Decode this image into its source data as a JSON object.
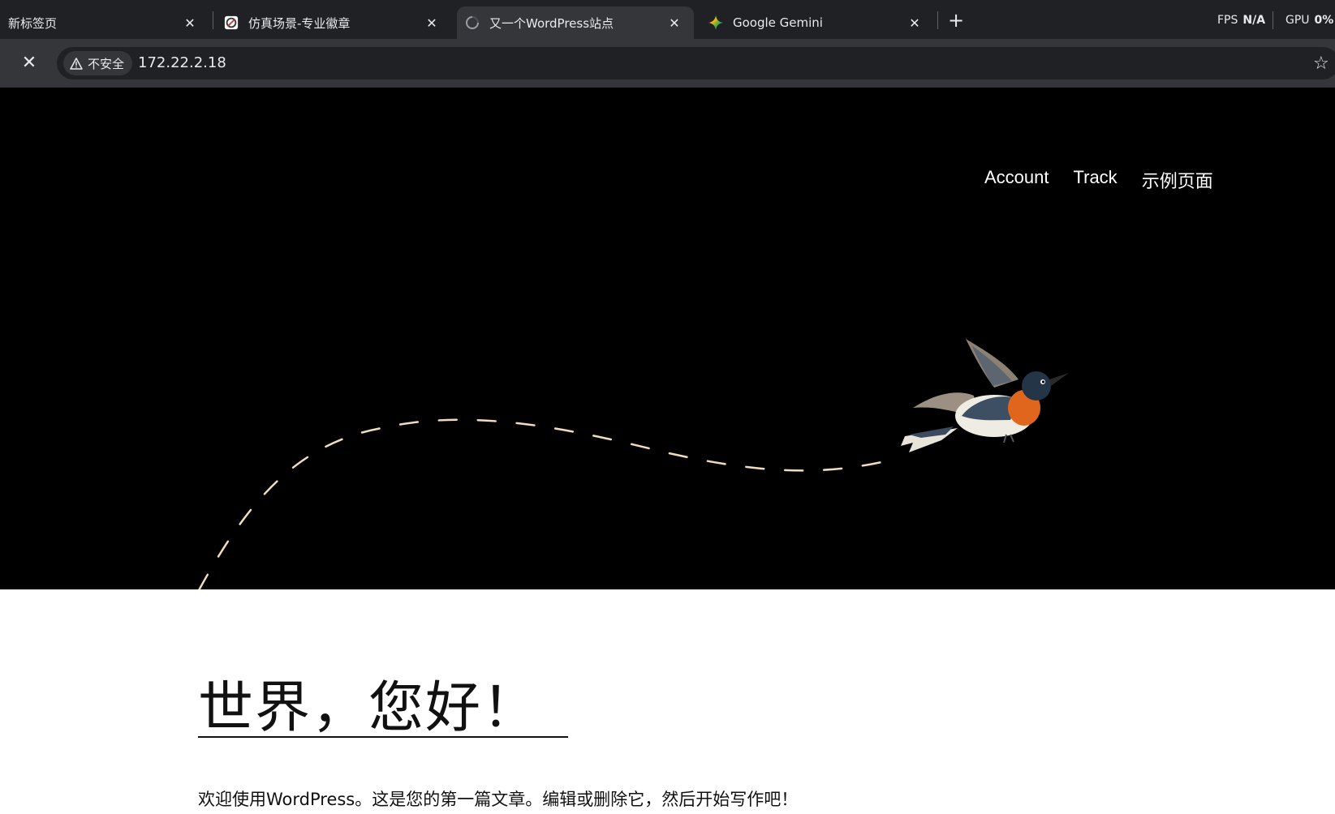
{
  "browser": {
    "tabs": [
      {
        "title": "新标签页",
        "icon": "none",
        "active": false
      },
      {
        "title": "仿真场景-专业徽章",
        "icon": "badge-favicon",
        "active": false
      },
      {
        "title": "又一个WordPress站点",
        "icon": "loading-spinner",
        "active": true
      },
      {
        "title": "Google Gemini",
        "icon": "gemini-star",
        "active": false
      }
    ],
    "new_tab_label": "+",
    "close_glyph": "✕",
    "stats": {
      "fps_label": "FPS",
      "fps_value": "N/A",
      "gpu_label": "GPU",
      "gpu_value": "0%"
    },
    "security_label": "不安全",
    "url": "172.22.2.18"
  },
  "site": {
    "nav": [
      "Account",
      "Track",
      "示例页面"
    ],
    "post_title": "世界，您好！",
    "post_excerpt": "欢迎使用WordPress。这是您的第一篇文章。编辑或删除它，然后开始写作吧！"
  },
  "colors": {
    "tabbar": "#202124",
    "toolbar": "#35363a",
    "hero_bg": "#000000",
    "path_dash": "#f2dcc0",
    "bird_orange": "#e0661d"
  }
}
